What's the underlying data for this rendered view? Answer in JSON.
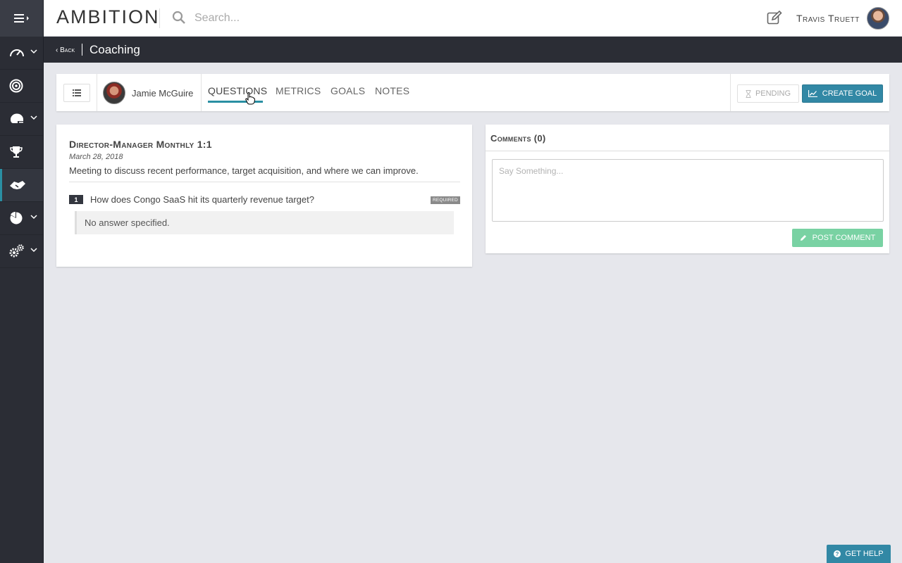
{
  "topbar": {
    "logo": "AMBITION",
    "search_placeholder": "Search...",
    "user_name": "Travis Truett"
  },
  "subbar": {
    "back_label": "‹ Back",
    "title": "Coaching"
  },
  "profile": {
    "name": "Jamie McGuire",
    "tabs": [
      {
        "label": "QUESTIONS",
        "active": true
      },
      {
        "label": "METRICS",
        "active": false
      },
      {
        "label": "GOALS",
        "active": false
      },
      {
        "label": "NOTES",
        "active": false
      }
    ],
    "pending_label": "PENDING",
    "create_goal_label": "CREATE GOAL"
  },
  "meeting": {
    "title": "Director-Manager Monthly 1:1",
    "date": "March 28, 2018",
    "description": "Meeting to discuss recent performance, target acquisition, and where we can improve.",
    "questions": [
      {
        "number": "1",
        "text": "How does Congo SaaS hit its quarterly revenue target?",
        "badge": "REQUIRED",
        "answer": "No answer specified."
      }
    ]
  },
  "comments": {
    "title": "Comments (0)",
    "input_placeholder": "Say Something...",
    "post_label": "POST COMMENT"
  },
  "help": {
    "label": "GET HELP"
  },
  "colors": {
    "accent": "#3288a5",
    "rail_bg": "#2b2d35",
    "post_button": "#79d2a3"
  },
  "icons": {
    "rail": [
      "menu-icon",
      "dashboard-icon",
      "target-icon",
      "helmet-icon",
      "trophy-icon",
      "handshake-icon",
      "pie-chart-icon",
      "settings-icon"
    ]
  }
}
